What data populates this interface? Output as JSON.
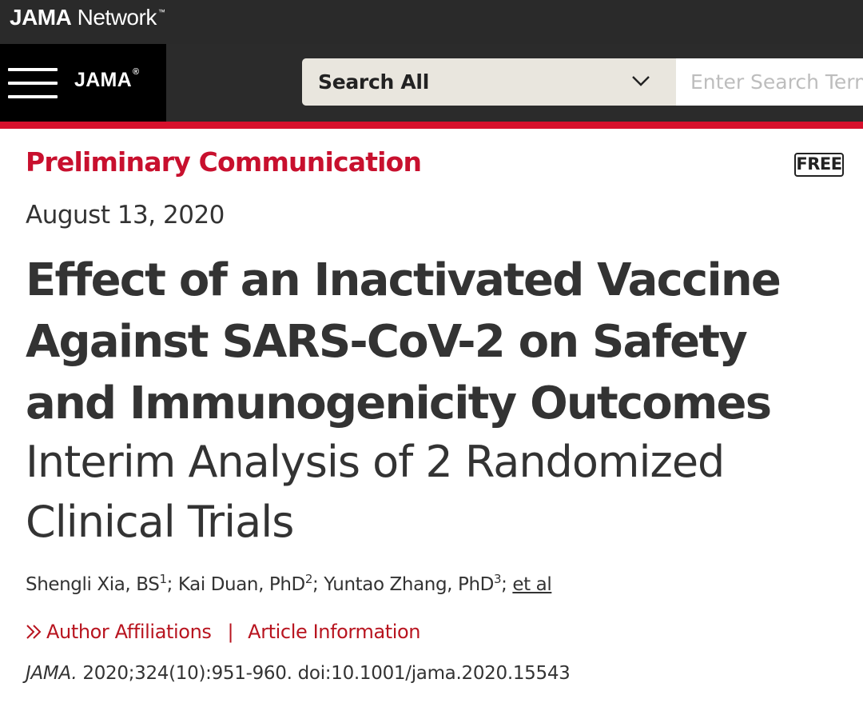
{
  "network_bar": {
    "brand_bold": "JAMA",
    "brand_rest": " Network",
    "trademark": "™"
  },
  "header": {
    "logo_text": "JAMA",
    "logo_reg": "®",
    "search_scope": "Search All",
    "search_placeholder": "Enter Search Term",
    "icons": [
      "hamburger-menu-icon",
      "chevron-down-icon"
    ]
  },
  "article": {
    "type": "Preliminary Communication",
    "access_badge": "FREE",
    "date": "August 13, 2020",
    "title": "Effect of an Inactivated Vaccine Against SARS-CoV-2 on Safety and Immunogenicity Outcomes",
    "subtitle": "Interim Analysis of 2 Randomized Clinical Trials",
    "authors": [
      {
        "name": "Shengli Xia, BS",
        "sup": "1"
      },
      {
        "name": "Kai Duan, PhD",
        "sup": "2"
      },
      {
        "name": "Yuntao Zhang, PhD",
        "sup": "3"
      }
    ],
    "et_al": "et al",
    "links": {
      "affiliations": "Author Affiliations",
      "separator": "|",
      "article_info": "Article Information"
    },
    "citation": {
      "journal": "JAMA.",
      "details": " 2020;324(10):951-960. doi:10.1001/jama.2020.15543"
    }
  },
  "colors": {
    "accent_red": "#c8102e",
    "header_bg": "#2b2b2b",
    "text": "#333333"
  }
}
